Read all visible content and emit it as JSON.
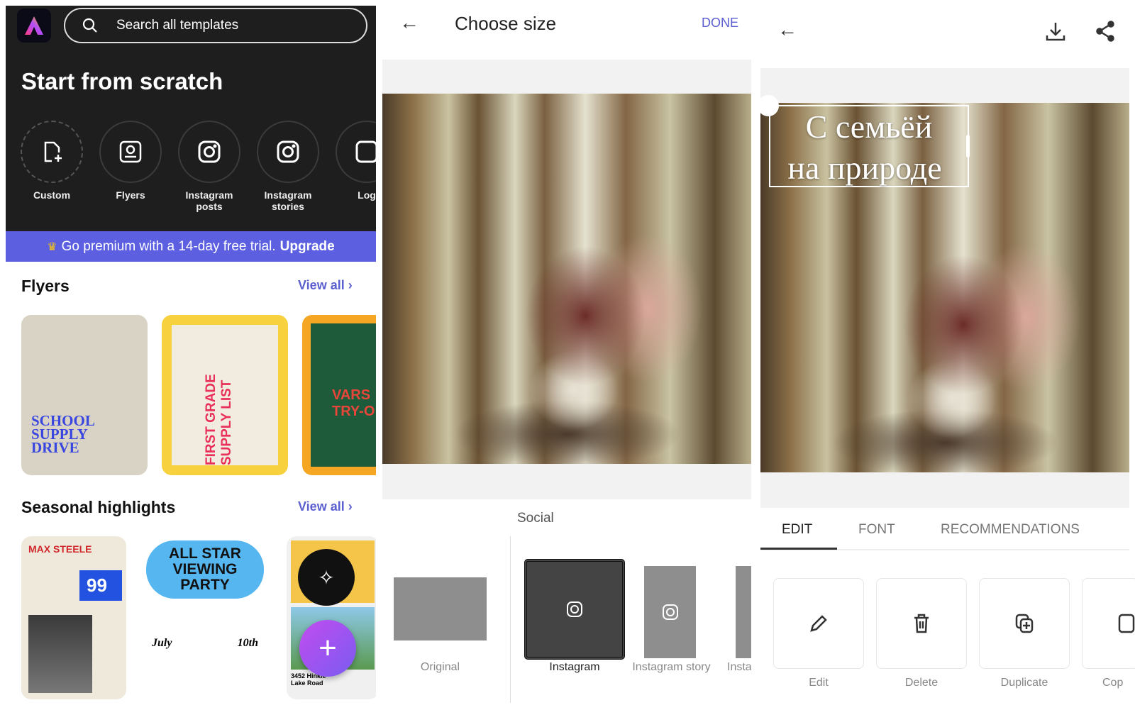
{
  "left": {
    "search_placeholder": "Search all templates",
    "title": "Start from scratch",
    "scratch_items": [
      {
        "label": "Custom"
      },
      {
        "label": "Flyers"
      },
      {
        "label": "Instagram posts"
      },
      {
        "label": "Instagram stories"
      },
      {
        "label": "Log"
      }
    ],
    "premium_text": "Go premium with a 14-day free trial.",
    "premium_link": "Upgrade",
    "sections": [
      {
        "title": "Flyers",
        "view_all": "View all",
        "cards": [
          {
            "title": "SCHOOL SUPPLY DRIVE"
          },
          {
            "title": "FIRST GRADE SUPPLY LIST"
          },
          {
            "title": "VARS TRY-O"
          }
        ]
      },
      {
        "title": "Seasonal highlights",
        "view_all": "View all",
        "cards": [
          {
            "title": "MAX STEELE",
            "number": "99"
          },
          {
            "title": "ALL STAR VIEWING PARTY",
            "date_left": "July",
            "date_right": "10th"
          },
          {
            "title": "3452 Hinkle Lake Road"
          }
        ]
      }
    ],
    "colors": {
      "accent": "#5b5fe0",
      "dark": "#1e1e1e"
    }
  },
  "middle": {
    "title": "Choose size",
    "done": "DONE",
    "category": "Social",
    "sizes": [
      {
        "label": "Original"
      },
      {
        "label": "Instagram",
        "selected": true
      },
      {
        "label": "Instagram story"
      },
      {
        "label": "Insta"
      }
    ]
  },
  "right": {
    "overlay_line1": "С семьёй",
    "overlay_line2": "на природе",
    "tabs": [
      {
        "label": "EDIT",
        "active": true
      },
      {
        "label": "FONT"
      },
      {
        "label": "RECOMMENDATIONS"
      }
    ],
    "actions": [
      {
        "label": "Edit",
        "icon": "pencil-icon"
      },
      {
        "label": "Delete",
        "icon": "trash-icon"
      },
      {
        "label": "Duplicate",
        "icon": "duplicate-icon"
      },
      {
        "label": "Cop",
        "icon": "copy-icon"
      }
    ]
  }
}
